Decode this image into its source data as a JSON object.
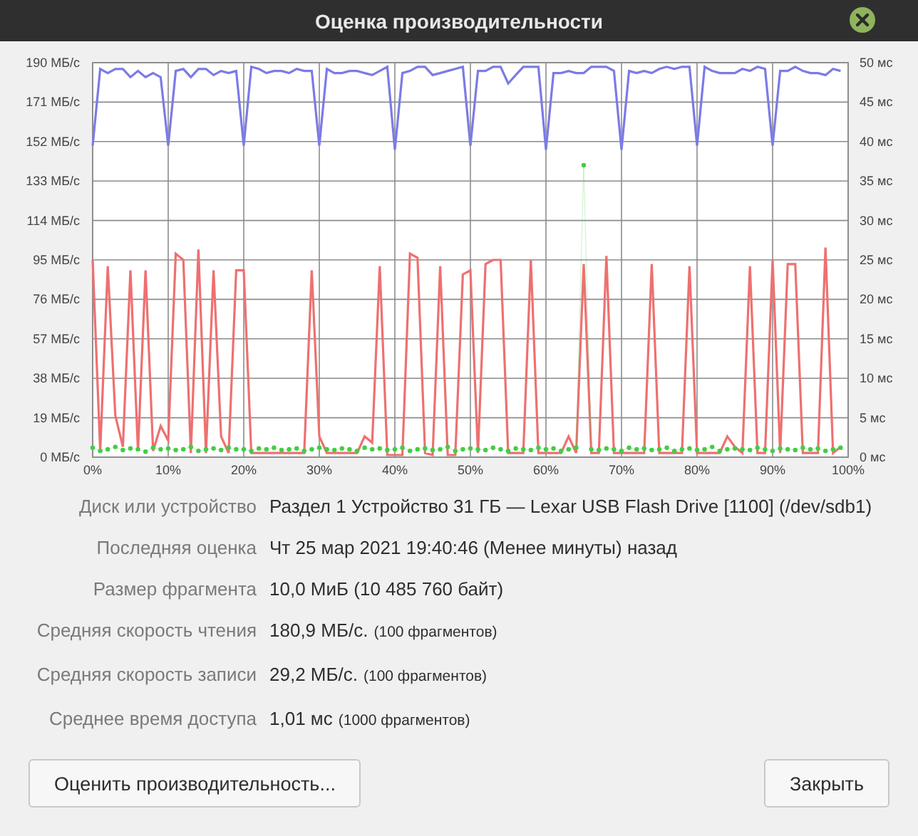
{
  "window": {
    "title": "Оценка производительности"
  },
  "chart": {
    "chart_data": {
      "type": "line",
      "x": [
        0,
        1,
        2,
        3,
        4,
        5,
        6,
        7,
        8,
        9,
        10,
        11,
        12,
        13,
        14,
        15,
        16,
        17,
        18,
        19,
        20,
        21,
        22,
        23,
        24,
        25,
        26,
        27,
        28,
        29,
        30,
        31,
        32,
        33,
        34,
        35,
        36,
        37,
        38,
        39,
        40,
        41,
        42,
        43,
        44,
        45,
        46,
        47,
        48,
        49,
        50,
        51,
        52,
        53,
        54,
        55,
        56,
        57,
        58,
        59,
        60,
        61,
        62,
        63,
        64,
        65,
        66,
        67,
        68,
        69,
        70,
        71,
        72,
        73,
        74,
        75,
        76,
        77,
        78,
        79,
        80,
        81,
        82,
        83,
        84,
        85,
        86,
        87,
        88,
        89,
        90,
        91,
        92,
        93,
        94,
        95,
        96,
        97,
        98,
        99
      ],
      "xlim": [
        0,
        100
      ],
      "ylim": [
        0,
        190
      ],
      "xticks": [
        {
          "value": 0,
          "label": "0%"
        },
        {
          "value": 10,
          "label": "10%"
        },
        {
          "value": 20,
          "label": "20%"
        },
        {
          "value": 30,
          "label": "30%"
        },
        {
          "value": 40,
          "label": "40%"
        },
        {
          "value": 50,
          "label": "50%"
        },
        {
          "value": 60,
          "label": "60%"
        },
        {
          "value": 70,
          "label": "70%"
        },
        {
          "value": 80,
          "label": "80%"
        },
        {
          "value": 90,
          "label": "90%"
        },
        {
          "value": 100,
          "label": "100%"
        }
      ],
      "yticks": [
        {
          "value": 0,
          "label": "0 МБ/с"
        },
        {
          "value": 19,
          "label": "19 МБ/с"
        },
        {
          "value": 38,
          "label": "38 МБ/с"
        },
        {
          "value": 57,
          "label": "57 МБ/с"
        },
        {
          "value": 76,
          "label": "76 МБ/с"
        },
        {
          "value": 95,
          "label": "95 МБ/с"
        },
        {
          "value": 114,
          "label": "114 МБ/с"
        },
        {
          "value": 133,
          "label": "133 МБ/с"
        },
        {
          "value": 152,
          "label": "152 МБ/с"
        },
        {
          "value": 171,
          "label": "171 МБ/с"
        },
        {
          "value": 190,
          "label": "190 МБ/с"
        }
      ],
      "grid": true,
      "y2lim": [
        0,
        50
      ],
      "y2ticks": [
        {
          "value": 0,
          "label": "0 мс"
        },
        {
          "value": 5,
          "label": "5 мс"
        },
        {
          "value": 10,
          "label": "10 мс"
        },
        {
          "value": 15,
          "label": "15 мс"
        },
        {
          "value": 20,
          "label": "20 мс"
        },
        {
          "value": 25,
          "label": "25 мс"
        },
        {
          "value": 30,
          "label": "30 мс"
        },
        {
          "value": 35,
          "label": "35 мс"
        },
        {
          "value": 40,
          "label": "40 мс"
        },
        {
          "value": 45,
          "label": "45 мс"
        },
        {
          "value": 50,
          "label": "50 мс"
        }
      ],
      "series": [
        {
          "color": "#7b7be6",
          "values": [
            150,
            187,
            185,
            187,
            187,
            183,
            186,
            183,
            185,
            183,
            150,
            186,
            187,
            183,
            187,
            187,
            184,
            186,
            185,
            186,
            150,
            188,
            187,
            185,
            186,
            186,
            185,
            187,
            186,
            186,
            150,
            187,
            185,
            185,
            186,
            186,
            185,
            184,
            186,
            188,
            148,
            185,
            186,
            188,
            188,
            184,
            185,
            186,
            187,
            188,
            150,
            186,
            186,
            188,
            188,
            180,
            184,
            188,
            188,
            188,
            148,
            185,
            185,
            186,
            185,
            185,
            188,
            188,
            188,
            186,
            148,
            186,
            185,
            186,
            185,
            187,
            188,
            187,
            188,
            188,
            150,
            188,
            186,
            185,
            185,
            185,
            187,
            186,
            188,
            187,
            150,
            186,
            186,
            188,
            186,
            185,
            185,
            184,
            187,
            186
          ]
        },
        {
          "color": "#ee7070",
          "values": [
            95,
            3,
            92,
            20,
            5,
            90,
            3,
            90,
            3,
            15,
            8,
            98,
            95,
            2,
            100,
            2,
            90,
            10,
            2,
            90,
            90,
            2,
            2,
            2,
            2,
            2,
            2,
            2,
            2,
            90,
            10,
            2,
            2,
            2,
            2,
            2,
            10,
            7,
            92,
            1,
            1,
            1,
            98,
            96,
            2,
            1,
            92,
            1,
            1,
            88,
            90,
            2,
            93,
            95,
            95,
            2,
            2,
            2,
            95,
            2,
            2,
            2,
            2,
            10,
            2,
            93,
            2,
            2,
            97,
            2,
            2,
            2,
            2,
            2,
            93,
            2,
            2,
            2,
            2,
            92,
            2,
            2,
            2,
            2,
            10,
            5,
            2,
            92,
            2,
            2,
            95,
            2,
            93,
            93,
            2,
            2,
            2,
            101,
            2,
            5
          ]
        },
        {
          "color": "#44cc44",
          "axis": "y2",
          "marker": "circle",
          "values": [
            1.2,
            0.8,
            1.0,
            1.3,
            0.9,
            1.1,
            1.0,
            0.7,
            1.2,
            1.0,
            1.1,
            0.9,
            1.0,
            1.3,
            0.8,
            1.0,
            1.1,
            0.9,
            1.2,
            1.0,
            1.0,
            0.8,
            1.1,
            1.0,
            1.2,
            0.9,
            1.0,
            1.1,
            0.8,
            1.0,
            1.2,
            1.0,
            0.9,
            1.1,
            1.0,
            0.8,
            1.2,
            1.0,
            1.1,
            0.9,
            1.0,
            1.2,
            0.8,
            1.0,
            1.1,
            0.9,
            1.0,
            1.3,
            0.8,
            1.0,
            1.1,
            1.0,
            0.9,
            1.2,
            1.0,
            0.8,
            1.1,
            1.0,
            0.9,
            1.2,
            1.0,
            1.1,
            0.8,
            1.0,
            1.2,
            37,
            1.0,
            0.9,
            1.1,
            1.0,
            0.8,
            1.2,
            1.0,
            1.1,
            0.9,
            1.0,
            1.2,
            0.8,
            1.0,
            1.1,
            0.9,
            1.0,
            1.3,
            0.8,
            1.0,
            1.1,
            1.0,
            0.9,
            1.2,
            1.0,
            0.8,
            1.1,
            1.0,
            0.9,
            1.2,
            1.0,
            1.1,
            0.8,
            1.0,
            1.2
          ]
        }
      ]
    }
  },
  "info": [
    {
      "label": "Диск или устройство",
      "value": "Раздел 1 Устройство 31 ГБ — Lexar USB Flash Drive [1100] (/dev/sdb1)"
    },
    {
      "label": "Последняя оценка",
      "value": "Чт 25 мар 2021 19:40:46 (Менее минуты) назад"
    },
    {
      "label": "Размер фрагмента",
      "value": "10,0 МиБ (10 485 760 байт)"
    },
    {
      "label": "Средняя скорость чтения",
      "value": "180,9 МБ/с.",
      "note": "(100 фрагментов)"
    },
    {
      "label": "Средняя скорость записи",
      "value": "29,2 МБ/с.",
      "note": "(100 фрагментов)"
    },
    {
      "label": "Среднее время доступа",
      "value": "1,01 мс",
      "note": "(1000 фрагментов)"
    }
  ],
  "buttons": [
    {
      "label": "Оценить производительность..."
    },
    {
      "label": "Закрыть"
    }
  ]
}
